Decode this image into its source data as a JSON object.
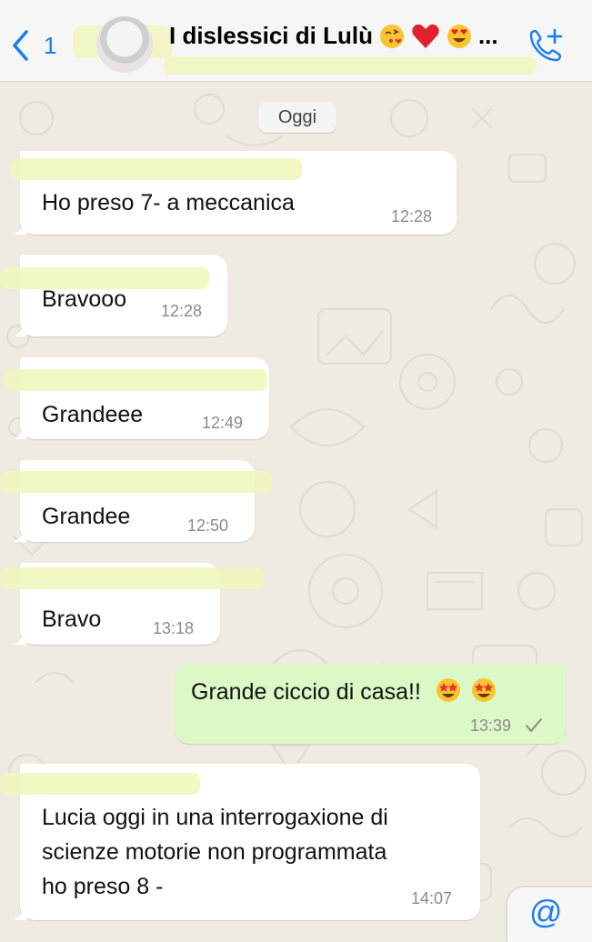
{
  "header": {
    "back_count": "1",
    "title": "I dislessici di Lulù",
    "title_emojis": [
      "kissing-heart-emoji",
      "red-heart-emoji",
      "heart-eyes-emoji"
    ],
    "title_ellipsis": "...",
    "accent_color": "#1a7cf2"
  },
  "chat": {
    "date_label": "Oggi",
    "messages": [
      {
        "direction": "incoming",
        "text": "Ho preso 7-  a meccanica",
        "time": "12:28"
      },
      {
        "direction": "incoming",
        "text": "Bravooo",
        "time": "12:28"
      },
      {
        "direction": "incoming",
        "text": "Grandeee",
        "time": "12:49"
      },
      {
        "direction": "incoming",
        "text": "Grandee",
        "time": "12:50"
      },
      {
        "direction": "incoming",
        "text": "Bravo",
        "time": "13:18"
      },
      {
        "direction": "outgoing",
        "text": "Grande ciccio di casa!!",
        "time": "13:39",
        "emojis": [
          "star-struck-emoji",
          "star-struck-emoji"
        ],
        "status": "sent-check-icon"
      },
      {
        "direction": "incoming",
        "lines": [
          "Lucia oggi in una interrogaxione di",
          "scienze motorie non programmata",
          "ho preso 8 -"
        ],
        "time": "14:07"
      }
    ]
  },
  "mention_button": {
    "label": "@"
  },
  "colors": {
    "chat_background": "#efeae2",
    "incoming_bubble": "#ffffff",
    "outgoing_bubble": "#dcf8c6",
    "redaction": "#f1f6be"
  }
}
